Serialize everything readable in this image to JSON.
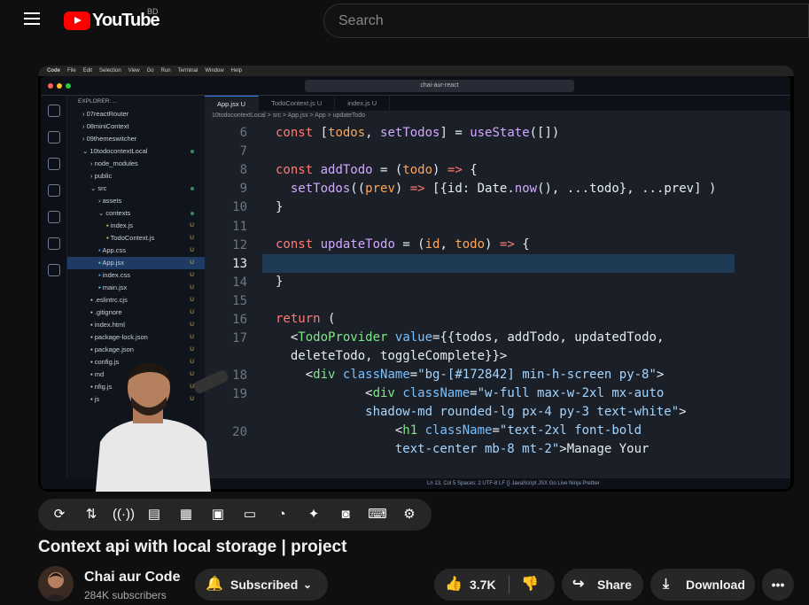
{
  "header": {
    "logo_text": "YouTube",
    "country_code": "BD",
    "search_placeholder": "Search"
  },
  "mac_menu": [
    "Code",
    "File",
    "Edit",
    "Selection",
    "View",
    "Go",
    "Run",
    "Terminal",
    "Window",
    "Help"
  ],
  "editor": {
    "command_center": "chai-aur-react",
    "explorer_title": "EXPLORER: ...",
    "tree": [
      {
        "label": "07reactRouter",
        "indent": 1,
        "type": "folder",
        "mark": ""
      },
      {
        "label": "08miniContext",
        "indent": 1,
        "type": "folder",
        "mark": ""
      },
      {
        "label": "09themeswitcher",
        "indent": 1,
        "type": "folder",
        "mark": ""
      },
      {
        "label": "10todocontextLocal",
        "indent": 1,
        "type": "folder-open",
        "mark": "dot"
      },
      {
        "label": "node_modules",
        "indent": 2,
        "type": "folder",
        "mark": ""
      },
      {
        "label": "public",
        "indent": 2,
        "type": "folder",
        "mark": ""
      },
      {
        "label": "src",
        "indent": 2,
        "type": "folder-open",
        "mark": "dot"
      },
      {
        "label": "assets",
        "indent": 3,
        "type": "folder",
        "mark": ""
      },
      {
        "label": "contexts",
        "indent": 3,
        "type": "folder-open",
        "mark": "dot"
      },
      {
        "label": "index.js",
        "indent": 4,
        "type": "js",
        "mark": "U"
      },
      {
        "label": "TodoContext.js",
        "indent": 4,
        "type": "js",
        "mark": "U"
      },
      {
        "label": "App.css",
        "indent": 3,
        "type": "css",
        "mark": "U"
      },
      {
        "label": "App.jsx",
        "indent": 3,
        "type": "jsx",
        "mark": "U",
        "selected": true
      },
      {
        "label": "index.css",
        "indent": 3,
        "type": "css",
        "mark": "U"
      },
      {
        "label": "main.jsx",
        "indent": 3,
        "type": "jsx",
        "mark": "U"
      },
      {
        "label": ".eslintrc.cjs",
        "indent": 2,
        "type": "file",
        "mark": "U"
      },
      {
        "label": ".gitignore",
        "indent": 2,
        "type": "file",
        "mark": "U"
      },
      {
        "label": "index.html",
        "indent": 2,
        "type": "file",
        "mark": "U"
      },
      {
        "label": "package-lock.json",
        "indent": 2,
        "type": "file",
        "mark": "U"
      },
      {
        "label": "package.json",
        "indent": 2,
        "type": "file",
        "mark": "U"
      },
      {
        "label": "config.js",
        "indent": 2,
        "type": "file",
        "mark": "U"
      },
      {
        "label": "md",
        "indent": 2,
        "type": "file",
        "mark": "U"
      },
      {
        "label": "nfig.js",
        "indent": 2,
        "type": "file",
        "mark": "U"
      },
      {
        "label": "js",
        "indent": 2,
        "type": "file",
        "mark": "U"
      }
    ],
    "tabs": [
      {
        "label": "App.jsx U",
        "active": true
      },
      {
        "label": "TodoContext.js U",
        "active": false
      },
      {
        "label": "index.js U",
        "active": false
      }
    ],
    "breadcrumb": "10todocontextLocal > src > App.jsx > App > updateTodo",
    "line_numbers": [
      "6",
      "7",
      "8",
      "9",
      "10",
      "11",
      "12",
      "13",
      "14",
      "15",
      "16",
      "17",
      "",
      "18",
      "19",
      "",
      "20",
      ""
    ],
    "status_text": "Ln 13, Col 5   Spaces: 2   UTF-8   LF   {} JavaScript JSX   Go Live   Ninja   Prettier"
  },
  "controls": {
    "icons": [
      "loop-icon",
      "sort-icon",
      "broadcast-icon",
      "preview-icon",
      "clapper-icon",
      "picture-in-picture-icon",
      "subtitles-icon",
      "speed-icon",
      "sparkle-icon",
      "screenshot-icon",
      "keyboard-icon",
      "settings-icon"
    ]
  },
  "video_title": "Context api with local storage | project",
  "channel": {
    "name": "Chai aur Code",
    "subscribers": "284K subscribers",
    "subscribe_label": "Subscribed"
  },
  "actions": {
    "likes": "3.7K",
    "share": "Share",
    "download": "Download"
  },
  "colors": {
    "yt_red": "#ff0000",
    "background": "#0f0f0f",
    "pill": "#272727"
  }
}
